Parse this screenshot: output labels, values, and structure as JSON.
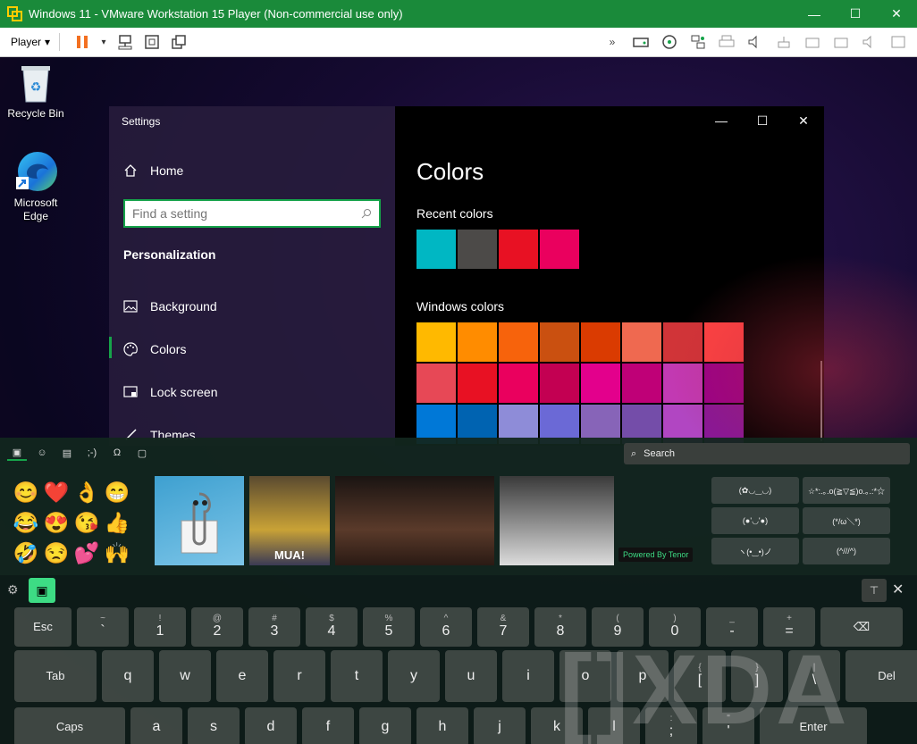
{
  "vm": {
    "title": "Windows 11 - VMware Workstation 15 Player (Non-commercial use only)",
    "player_label": "Player",
    "win_controls": [
      "—",
      "☐",
      "✕"
    ]
  },
  "desktop": {
    "icons": [
      {
        "label": "Recycle Bin"
      },
      {
        "label": "Microsoft Edge"
      }
    ]
  },
  "settings": {
    "app_title": "Settings",
    "home_label": "Home",
    "search_placeholder": "Find a setting",
    "section": "Personalization",
    "nav": [
      {
        "label": "Background"
      },
      {
        "label": "Colors"
      },
      {
        "label": "Lock screen"
      },
      {
        "label": "Themes"
      }
    ],
    "page_title": "Colors",
    "recent_colors_label": "Recent colors",
    "recent_colors": [
      "#00b7c3",
      "#4c4a48",
      "#e81123",
      "#ea005e"
    ],
    "windows_colors_label": "Windows colors",
    "windows_colors": [
      "#ffb900",
      "#ff8c00",
      "#f7630c",
      "#ca5010",
      "#da3b01",
      "#ef6950",
      "#d13438",
      "#ff4343",
      "#e74856",
      "#e81123",
      "#ea005e",
      "#c30052",
      "#e3008c",
      "#bf0077",
      "#c239b3",
      "#9a0089",
      "#0078d7",
      "#0063b1",
      "#8e8cd8",
      "#6b69d6",
      "#8764b8",
      "#744da9",
      "#b146c2",
      "#881798"
    ]
  },
  "panel": {
    "search_placeholder": "Search",
    "emojis": [
      "😊",
      "❤️",
      "👌",
      "😁",
      "😂",
      "😍",
      "😘",
      "👍",
      "🤣",
      "😒",
      "💕",
      "🙌"
    ],
    "gif_caption": "MUA!",
    "tenor": "Powered By Tenor",
    "kaomoji": [
      "(✿◡‿◡)",
      "☆*:.｡.o(≧▽≦)o.｡.:*☆",
      "(●'◡'●)",
      "(*/ω＼*)",
      "ヽ(•‿•)ノ",
      "(^///^)"
    ]
  },
  "keyboard": {
    "row1": [
      {
        "s": "",
        "m": "Esc"
      },
      {
        "s": "~",
        "m": "`"
      },
      {
        "s": "!",
        "m": "1"
      },
      {
        "s": "@",
        "m": "2"
      },
      {
        "s": "#",
        "m": "3"
      },
      {
        "s": "$",
        "m": "4"
      },
      {
        "s": "%",
        "m": "5"
      },
      {
        "s": "^",
        "m": "6"
      },
      {
        "s": "&",
        "m": "7"
      },
      {
        "s": "*",
        "m": "8"
      },
      {
        "s": "(",
        "m": "9"
      },
      {
        "s": ")",
        "m": "0"
      },
      {
        "s": "_",
        "m": "-"
      },
      {
        "s": "+",
        "m": "="
      },
      {
        "s": "",
        "m": "⌫"
      }
    ],
    "row2": [
      {
        "s": "",
        "m": "Tab"
      },
      {
        "s": "",
        "m": "q"
      },
      {
        "s": "",
        "m": "w"
      },
      {
        "s": "",
        "m": "e"
      },
      {
        "s": "",
        "m": "r"
      },
      {
        "s": "",
        "m": "t"
      },
      {
        "s": "",
        "m": "y"
      },
      {
        "s": "",
        "m": "u"
      },
      {
        "s": "",
        "m": "i"
      },
      {
        "s": "",
        "m": "o"
      },
      {
        "s": "",
        "m": "p"
      },
      {
        "s": "{",
        "m": "["
      },
      {
        "s": "}",
        "m": "]"
      },
      {
        "s": "|",
        "m": "\\"
      },
      {
        "s": "",
        "m": "Del"
      }
    ],
    "row3": [
      {
        "s": "",
        "m": "Caps"
      },
      {
        "s": "",
        "m": "a"
      },
      {
        "s": "",
        "m": "s"
      },
      {
        "s": "",
        "m": "d"
      },
      {
        "s": "",
        "m": "f"
      },
      {
        "s": "",
        "m": "g"
      },
      {
        "s": "",
        "m": "h"
      },
      {
        "s": "",
        "m": "j"
      },
      {
        "s": "",
        "m": "k"
      },
      {
        "s": "",
        "m": "l"
      },
      {
        "s": ":",
        "m": ";"
      },
      {
        "s": "\"",
        "m": "'"
      },
      {
        "s": "",
        "m": "Enter"
      }
    ]
  },
  "watermark": "[]XDA"
}
